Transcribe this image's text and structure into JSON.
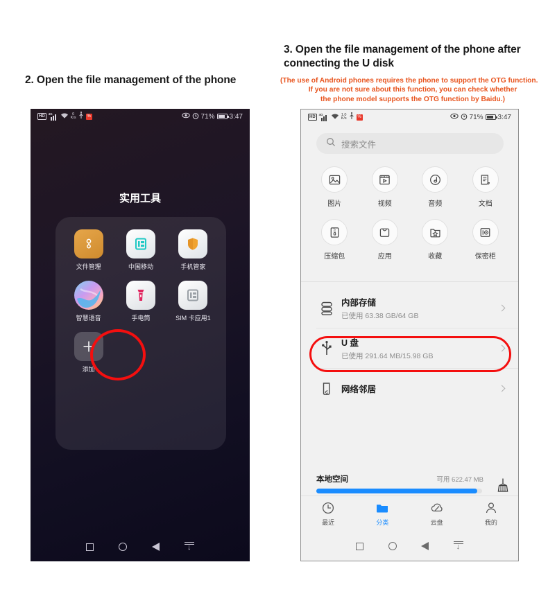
{
  "steps": {
    "left_caption": "2. Open the file management of the phone",
    "right_caption_line1": "3. Open the file management of the phone after",
    "right_caption_line2": "connecting the U disk",
    "note_line1": "(The use of Android phones requires the phone to support the OTG function.",
    "note_line2": "If you are not sure about this function, you can check whether",
    "note_line3": "the phone model supports the OTG function by Baidu.)",
    "note_color": "#e8541e",
    "highlight_color": "#f40f0f"
  },
  "status_bar": {
    "hd_label": "HD",
    "network_label": "4G",
    "speed_value_left": "0",
    "speed_value_right": "1.0",
    "speed_unit": "K/s",
    "battery_percent": "71%",
    "time": "3:47"
  },
  "left_phone": {
    "folder_title": "实用工具",
    "apps": [
      {
        "label": "文件管理",
        "icon": "file-manager-icon",
        "highlighted": true
      },
      {
        "label": "中国移动",
        "icon": "china-mobile-icon",
        "highlighted": false
      },
      {
        "label": "手机管家",
        "icon": "phone-manager-shield-icon",
        "highlighted": false
      },
      {
        "label": "智慧语音",
        "icon": "smart-voice-icon",
        "highlighted": false
      },
      {
        "label": "手电筒",
        "icon": "flashlight-icon",
        "highlighted": false
      },
      {
        "label": "SIM 卡应用1",
        "icon": "sim-card-icon",
        "highlighted": false
      },
      {
        "label": "添加",
        "icon": "plus-icon",
        "highlighted": false
      }
    ]
  },
  "right_phone": {
    "search": {
      "placeholder": "搜索文件",
      "icon": "search-icon"
    },
    "categories": [
      {
        "label": "图片",
        "icon": "image-icon"
      },
      {
        "label": "视频",
        "icon": "video-icon"
      },
      {
        "label": "音频",
        "icon": "audio-icon"
      },
      {
        "label": "文档",
        "icon": "document-icon"
      },
      {
        "label": "压缩包",
        "icon": "archive-icon"
      },
      {
        "label": "应用",
        "icon": "apps-bag-icon"
      },
      {
        "label": "收藏",
        "icon": "favorites-star-folder-icon"
      },
      {
        "label": "保密柜",
        "icon": "safe-box-icon"
      }
    ],
    "storage_rows": [
      {
        "name": "内部存储",
        "sub": "已使用 63.38 GB/64 GB",
        "icon": "internal-storage-icon",
        "highlighted": false
      },
      {
        "name": "U 盘",
        "sub": "已使用 291.64 MB/15.98 GB",
        "icon": "usb-icon",
        "highlighted": true
      },
      {
        "name": "网络邻居",
        "sub": "",
        "icon": "network-neighborhood-icon",
        "highlighted": false
      }
    ],
    "local_space": {
      "title": "本地空间",
      "available": "可用 622.47 MB",
      "used_percent": 97,
      "clean_icon": "broom-icon"
    },
    "tabs": [
      {
        "label": "最近",
        "icon": "clock-icon",
        "active": false
      },
      {
        "label": "分类",
        "icon": "folder-icon",
        "active": true
      },
      {
        "label": "云盘",
        "icon": "cloud-icon",
        "active": false
      },
      {
        "label": "我的",
        "icon": "person-icon",
        "active": false
      }
    ]
  },
  "nav_bar": {
    "recents": "square-icon",
    "home": "circle-icon",
    "back": "triangle-back-icon",
    "hide": "hide-navbar-icon"
  }
}
